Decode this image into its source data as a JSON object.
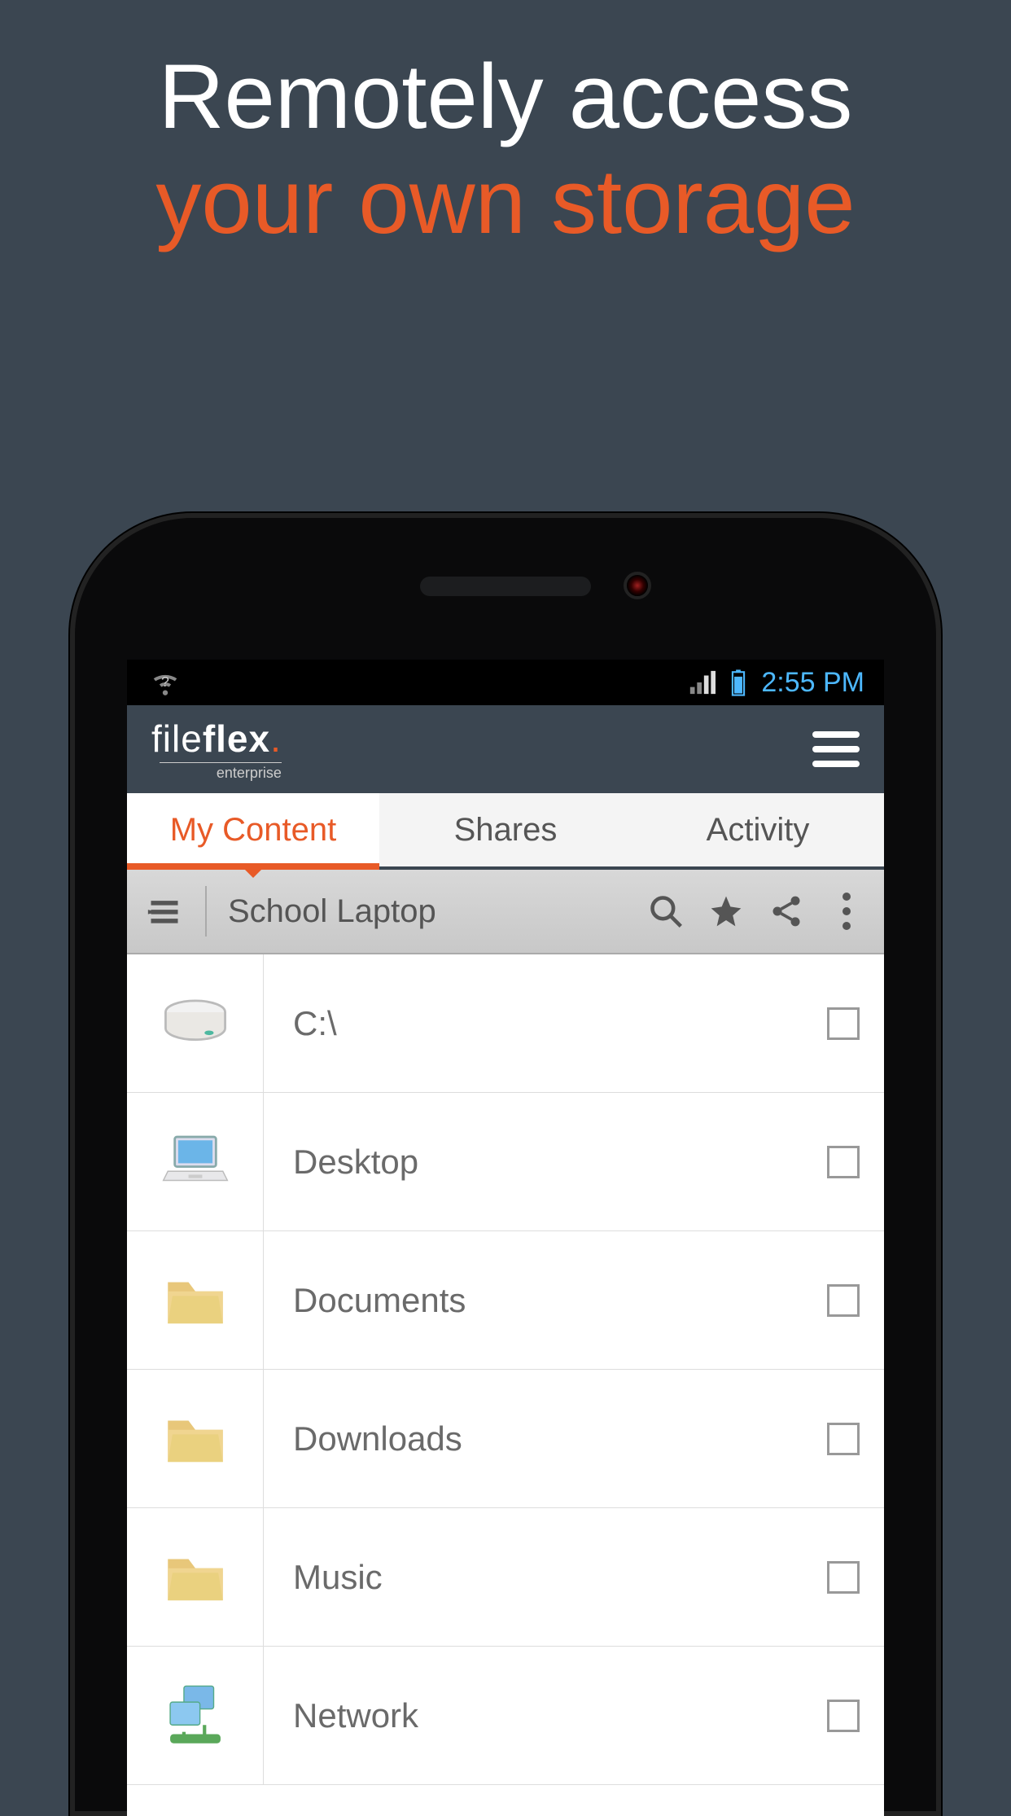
{
  "headline": {
    "line1": "Remotely access",
    "line2": "your own storage"
  },
  "statusbar": {
    "time": "2:55 PM"
  },
  "header": {
    "logo_light": "file",
    "logo_bold": "flex",
    "logo_sub": "enterprise"
  },
  "tabs": [
    {
      "label": "My Content",
      "active": true
    },
    {
      "label": "Shares",
      "active": false
    },
    {
      "label": "Activity",
      "active": false
    }
  ],
  "toolbar": {
    "breadcrumb": "School Laptop"
  },
  "files": [
    {
      "name": "C:\\",
      "icon": "drive"
    },
    {
      "name": "Desktop",
      "icon": "laptop"
    },
    {
      "name": "Documents",
      "icon": "folder"
    },
    {
      "name": "Downloads",
      "icon": "folder"
    },
    {
      "name": "Music",
      "icon": "folder"
    },
    {
      "name": "Network",
      "icon": "network"
    }
  ]
}
